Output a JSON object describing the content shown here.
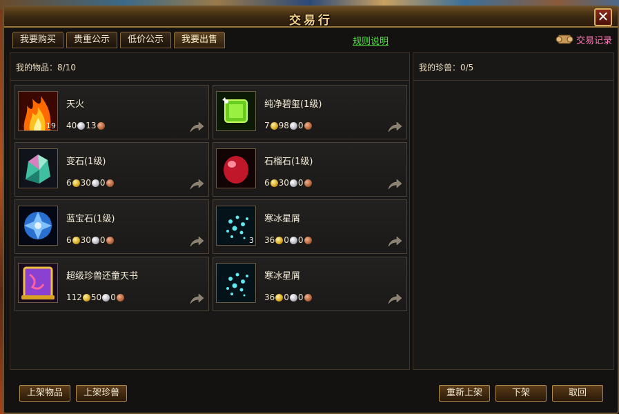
{
  "window": {
    "title": "交易行",
    "close_label": "✕"
  },
  "tabs": [
    {
      "label": "我要购买"
    },
    {
      "label": "贵重公示"
    },
    {
      "label": "低价公示"
    },
    {
      "label": "我要出售"
    }
  ],
  "rules_link": "规则说明",
  "trade_record": "交易记录",
  "my_items": {
    "label": "我的物品：8/10"
  },
  "my_pets": {
    "label": "我的珍兽：0/5"
  },
  "items": [
    {
      "name": "天火",
      "icon": "fire-icon",
      "count": "19",
      "price": [
        {
          "v": "40",
          "c": "silver"
        },
        {
          "v": "13",
          "c": "copper"
        }
      ]
    },
    {
      "name": "纯净碧玺(1级)",
      "icon": "green-gem-icon",
      "count": "",
      "price": [
        {
          "v": "7",
          "c": "gold"
        },
        {
          "v": "98",
          "c": "silver"
        },
        {
          "v": "0",
          "c": "copper"
        }
      ]
    },
    {
      "name": "变石(1级)",
      "icon": "alexandrite-icon",
      "count": "",
      "price": [
        {
          "v": "6",
          "c": "gold"
        },
        {
          "v": "30",
          "c": "silver"
        },
        {
          "v": "0",
          "c": "copper"
        }
      ]
    },
    {
      "name": "石榴石(1级)",
      "icon": "garnet-icon",
      "count": "",
      "price": [
        {
          "v": "6",
          "c": "gold"
        },
        {
          "v": "30",
          "c": "silver"
        },
        {
          "v": "0",
          "c": "copper"
        }
      ]
    },
    {
      "name": "蓝宝石(1级)",
      "icon": "sapphire-icon",
      "count": "",
      "price": [
        {
          "v": "6",
          "c": "gold"
        },
        {
          "v": "30",
          "c": "silver"
        },
        {
          "v": "0",
          "c": "copper"
        }
      ]
    },
    {
      "name": "寒冰星屑",
      "icon": "ice-stardust-icon",
      "count": "3",
      "price": [
        {
          "v": "36",
          "c": "gold"
        },
        {
          "v": "0",
          "c": "silver"
        },
        {
          "v": "0",
          "c": "copper"
        }
      ]
    },
    {
      "name": "超级珍兽还童天书",
      "icon": "scroll-book-icon",
      "count": "",
      "price": [
        {
          "v": "112",
          "c": "gold"
        },
        {
          "v": "50",
          "c": "silver"
        },
        {
          "v": "0",
          "c": "copper"
        }
      ]
    },
    {
      "name": "寒冰星屑",
      "icon": "ice-stardust-icon",
      "count": "",
      "price": [
        {
          "v": "36",
          "c": "gold"
        },
        {
          "v": "0",
          "c": "silver"
        },
        {
          "v": "0",
          "c": "copper"
        }
      ]
    }
  ],
  "buttons": {
    "list_item": "上架物品",
    "list_pet": "上架珍兽",
    "relist": "重新上架",
    "delist": "下架",
    "cancel": "取回"
  },
  "colors": {
    "gold_text": "#f2d08a",
    "link_green": "#50e040",
    "record_pink": "#ff7ab8",
    "frame_brown": "#6b5230"
  }
}
